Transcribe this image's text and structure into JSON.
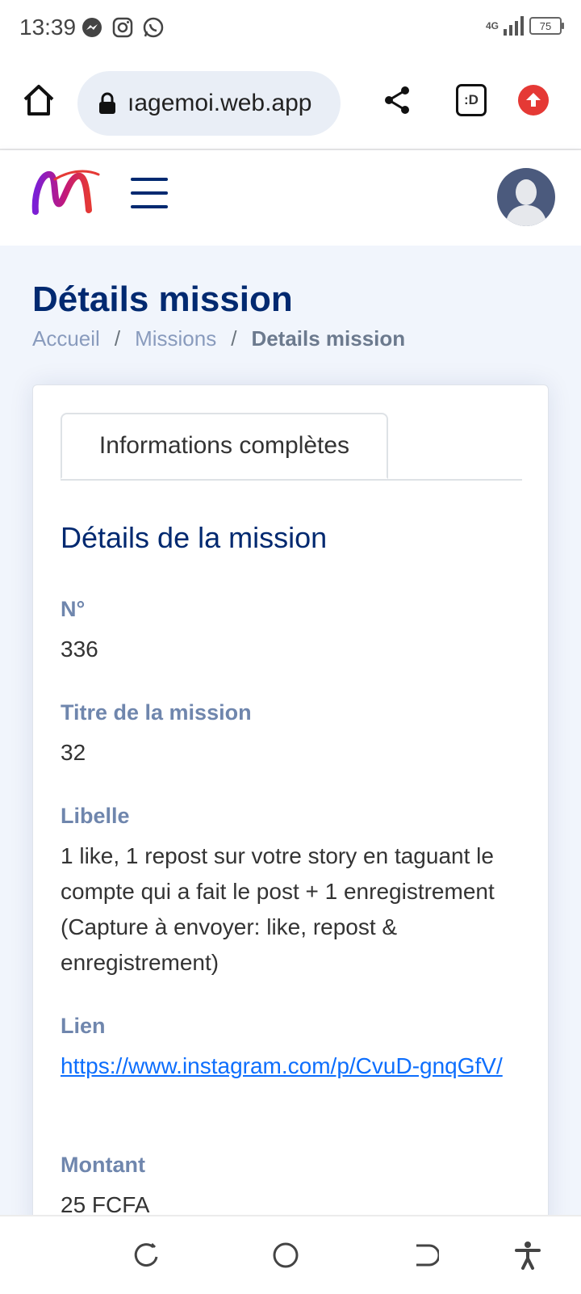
{
  "status_bar": {
    "time": "13:39",
    "network": "4G",
    "battery": "75",
    "notification_icons": [
      "messenger-icon",
      "instagram-icon",
      "whatsapp-icon"
    ]
  },
  "browser": {
    "url": "ıagemoi.web.app",
    "tabs_label": ":D"
  },
  "page": {
    "title": "Détails mission",
    "breadcrumb": [
      "Accueil",
      "Missions",
      "Details mission"
    ],
    "separator": "/"
  },
  "card": {
    "tab_label": "Informations complètes",
    "section_title": "Détails de la mission",
    "fields": [
      {
        "label": "N°",
        "value": "336"
      },
      {
        "label": "Titre de la mission",
        "value": "32"
      },
      {
        "label": "Libelle",
        "value": "1 like, 1 repost sur votre story en taguant le compte qui a fait le post + 1 enregistrement (Capture à envoyer: like, repost & enregistrement)"
      },
      {
        "label": "Lien",
        "value": "https://www.instagram.com/p/CvuD-gnqGfV/"
      },
      {
        "label": "Montant",
        "value": "25 FCFA"
      }
    ]
  },
  "colors": {
    "primary": "#012970",
    "label": "#6f86ad",
    "link": "#0d6efd",
    "background": "#f1f5fc",
    "update_badge": "#e53935"
  }
}
